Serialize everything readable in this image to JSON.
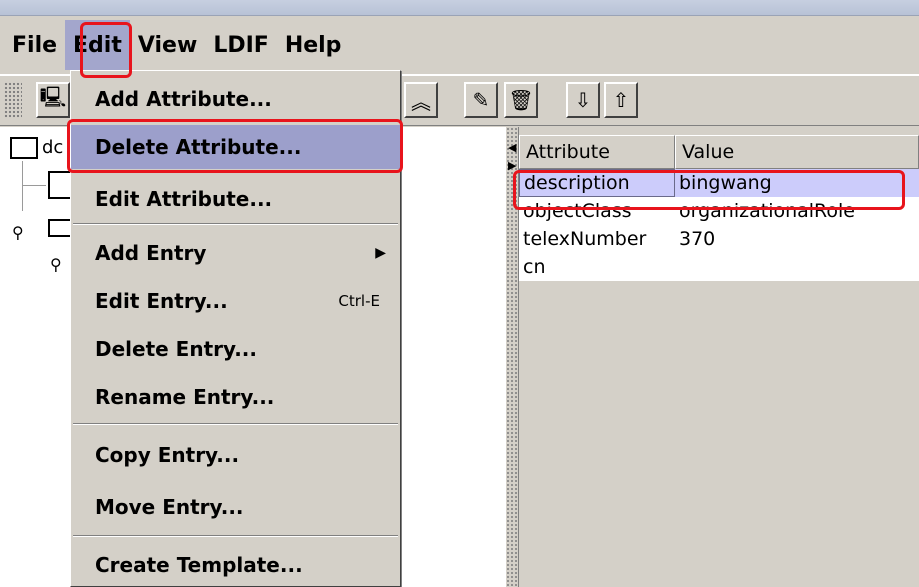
{
  "menubar": {
    "items": [
      {
        "label": "File",
        "active": false
      },
      {
        "label": "Edit",
        "active": true
      },
      {
        "label": "View",
        "active": false
      },
      {
        "label": "LDIF",
        "active": false
      },
      {
        "label": "Help",
        "active": false
      }
    ]
  },
  "toolbar": {
    "buttons": [
      {
        "icon": "computer-icon",
        "glyph": "🖳"
      },
      {
        "icon": "up-chevron-icon",
        "glyph": "︽"
      },
      {
        "icon": "edit-icon",
        "glyph": "✎"
      },
      {
        "icon": "trash-icon",
        "glyph": "🗑"
      },
      {
        "icon": "import-icon",
        "glyph": "⇩"
      },
      {
        "icon": "export-icon",
        "glyph": "⇧"
      }
    ]
  },
  "tree": {
    "root_label": "dc"
  },
  "edit_menu": {
    "items": [
      {
        "label": "Add Attribute...",
        "shortcut": "",
        "submenu": false,
        "highlighted": false
      },
      {
        "label": "Delete Attribute...",
        "shortcut": "",
        "submenu": false,
        "highlighted": true
      },
      {
        "label": "Edit Attribute...",
        "shortcut": "",
        "submenu": false,
        "highlighted": false
      },
      {
        "label": "Add Entry",
        "shortcut": "",
        "submenu": true,
        "highlighted": false
      },
      {
        "label": "Edit Entry...",
        "shortcut": "Ctrl-E",
        "submenu": false,
        "highlighted": false
      },
      {
        "label": "Delete Entry...",
        "shortcut": "",
        "submenu": false,
        "highlighted": false
      },
      {
        "label": "Rename Entry...",
        "shortcut": "",
        "submenu": false,
        "highlighted": false
      },
      {
        "label": "Copy Entry...",
        "shortcut": "",
        "submenu": false,
        "highlighted": false
      },
      {
        "label": "Move Entry...",
        "shortcut": "",
        "submenu": false,
        "highlighted": false
      },
      {
        "label": "Create Template...",
        "shortcut": "",
        "submenu": false,
        "highlighted": false
      }
    ]
  },
  "attributes": {
    "headers": [
      "Attribute",
      "Value"
    ],
    "rows": [
      {
        "attribute": "description",
        "value": "bingwang",
        "selected": true
      },
      {
        "attribute": "objectClass",
        "value": "organizationalRole",
        "selected": false
      },
      {
        "attribute": "telexNumber",
        "value": "370",
        "selected": false
      },
      {
        "attribute": "cn",
        "value": "",
        "selected": false
      }
    ]
  },
  "colors": {
    "menu_highlight": "#9c9fcb",
    "selected_row": "#ccccfb",
    "callout": "#e8141c"
  }
}
